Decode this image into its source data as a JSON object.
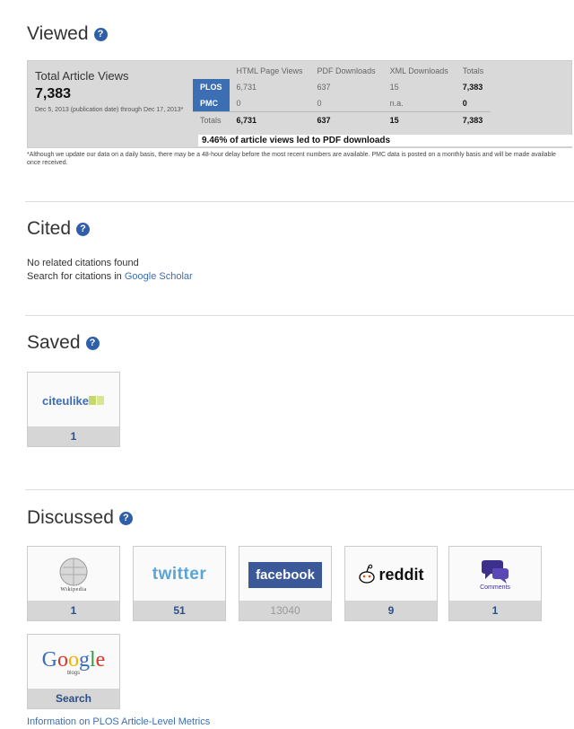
{
  "viewed": {
    "title": "Viewed",
    "total_label": "Total Article Views",
    "total_value": "7,383",
    "date_range": "Dec 5, 2013 (publication date) through Dec 17, 2013*",
    "columns": [
      "",
      "HTML Page Views",
      "PDF Downloads",
      "XML Downloads",
      "Totals"
    ],
    "rows": [
      {
        "source": "PLOS",
        "html": "6,731",
        "pdf": "637",
        "xml": "15",
        "total": "7,383"
      },
      {
        "source": "PMC",
        "html": "0",
        "pdf": "0",
        "xml": "n.a.",
        "total": "0"
      },
      {
        "source": "Totals",
        "html": "6,731",
        "pdf": "637",
        "xml": "15",
        "total": "7,383"
      }
    ],
    "pct_value": "9.46%",
    "pct_text": "of article views led to PDF downloads",
    "footnote": "*Although we update our data on a daily basis, there may be a 48-hour delay before the most recent numbers are available. PMC data is posted on a monthly basis and will be made available once received."
  },
  "cited": {
    "title": "Cited",
    "no_citations": "No related citations found",
    "search_prefix": "Search for citations in",
    "search_link": "Google Scholar"
  },
  "saved": {
    "title": "Saved",
    "tiles": [
      {
        "name": "citeulike",
        "count": "1"
      }
    ]
  },
  "discussed": {
    "title": "Discussed",
    "tiles": [
      {
        "name": "Wikipedia",
        "count": "1"
      },
      {
        "name": "twitter",
        "count": "51"
      },
      {
        "name": "facebook",
        "count": "13040"
      },
      {
        "name": "reddit",
        "count": "9"
      },
      {
        "name": "Comments",
        "count": "1"
      },
      {
        "name": "Google",
        "sub": "blogs",
        "count": "Search"
      }
    ]
  },
  "help_glyph": "?",
  "footer_link": "Information on PLOS Article-Level Metrics"
}
